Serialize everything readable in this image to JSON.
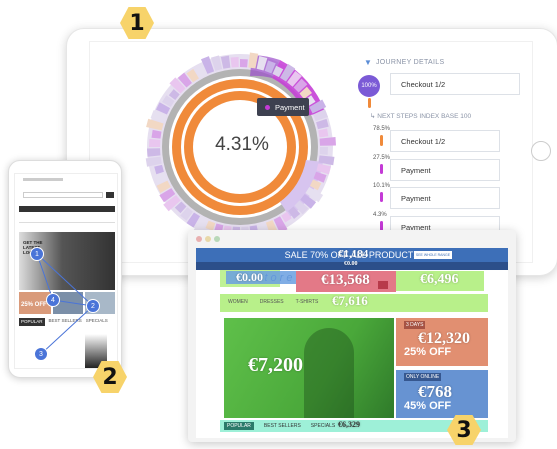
{
  "badges": {
    "one": "1",
    "two": "2",
    "three": "3"
  },
  "journey": {
    "title": "JOURNEY DETAILS",
    "center_value": "4.31%",
    "tooltip": "Payment",
    "start_percent": "100%",
    "start_step": "Checkout 1/2",
    "next_steps_label": "NEXT STEPS INDEX BASE 100",
    "steps": [
      {
        "percent": "78.5%",
        "label": "Checkout 1/2",
        "color": "#f08a3a"
      },
      {
        "percent": "27.5%",
        "label": "Payment",
        "color": "#c43ad6"
      },
      {
        "percent": "10.1%",
        "label": "Payment",
        "color": "#c43ad6"
      },
      {
        "percent": "4.3%",
        "label": "Payment",
        "color": "#c43ad6"
      }
    ]
  },
  "phone": {
    "hero_text": "GET THE LATEST LOOKS",
    "sale_text": "25% OFF",
    "tabs": [
      "POPULAR",
      "BEST SELLERS",
      "SPECIALS"
    ],
    "markers": [
      "1",
      "2",
      "3",
      "4"
    ]
  },
  "desktop": {
    "banner": "SALE 70% OFF ALL PRODUCTS",
    "banner_overlay": "€1,184",
    "banner_button": "SEE WHOLE RANGE",
    "store_text": "store",
    "price_search": "€0.00",
    "price_overlay_small": "€0.00",
    "price_basket": "€13,568",
    "price_right": "€6,496",
    "nav": [
      "WOMEN",
      "DRESSES",
      "T-SHIRTS"
    ],
    "nav_overlay": "€7,616",
    "hero_price": "€7,200",
    "promo1_tag": "3 DAYS",
    "promo1_price": "€12,320",
    "promo1_sale": "25% OFF",
    "promo2_tag": "ONLY ONLINE",
    "promo2_price": "€768",
    "promo2_sale": "45% OFF",
    "footer_tabs": [
      "POPULAR",
      "BEST SELLERS",
      "SPECIALS"
    ],
    "footer_overlay": "€6,329"
  }
}
